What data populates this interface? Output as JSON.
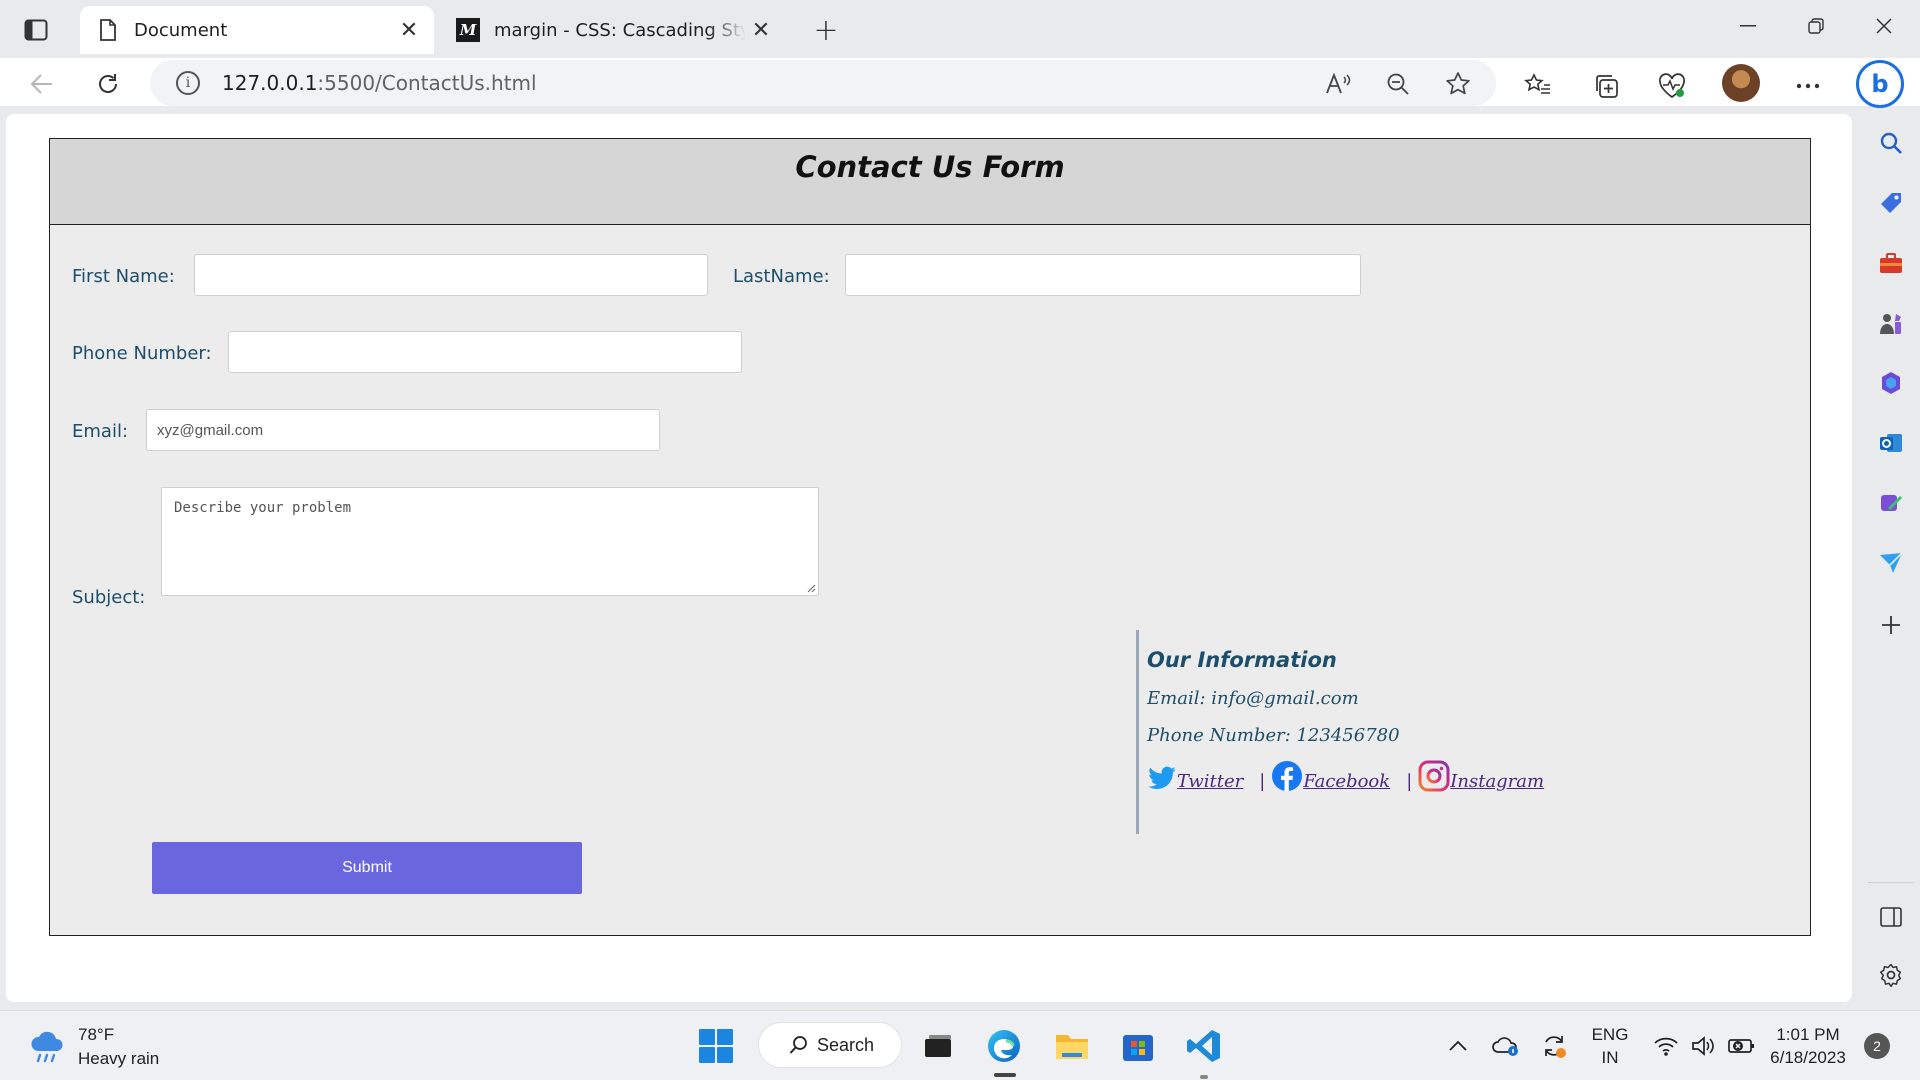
{
  "browser": {
    "tabs": [
      {
        "title": "Document",
        "close_label": "✕"
      },
      {
        "title": "margin - CSS: Cascading Style Sh",
        "close_label": "✕",
        "favicon_text": "M"
      }
    ],
    "new_tab_label": "+",
    "address": {
      "host": "127.0.0.1",
      "path": ":5500/ContactUs.html",
      "info_label": "i"
    },
    "bing_label": "b"
  },
  "page": {
    "header_title": "Contact Us Form",
    "form": {
      "first_name_label": "First Name:",
      "first_name_value": "",
      "last_name_label": "LastName:",
      "last_name_value": "",
      "phone_label": "Phone Number:",
      "phone_value": "",
      "email_label": "Email:",
      "email_placeholder": "xyz@gmail.com",
      "subject_label": "Subject:",
      "subject_placeholder": "Describe your problem",
      "submit_label": "Submit"
    },
    "info": {
      "heading": "Our Information",
      "email": "Email: info@gmail.com",
      "phone": "Phone Number: 123456780",
      "social": [
        {
          "label": " Twitter",
          "icon": "twitter-icon",
          "color": "#1d9bf0"
        },
        {
          "label": " Facebook",
          "icon": "facebook-icon",
          "color": "#1877f2"
        },
        {
          "label": " Instagram",
          "icon": "instagram-icon",
          "color": "#c13584"
        }
      ],
      "separator": "|"
    }
  },
  "taskbar": {
    "weather_temp": "78°F",
    "weather_desc": "Heavy rain",
    "search_label": "Search",
    "lang_top": "ENG",
    "lang_bottom": "IN",
    "time": "1:01 PM",
    "date": "6/18/2023",
    "notification_count": "2"
  },
  "colors": {
    "accent_button": "#6a67de",
    "label_text": "#1d4e6b",
    "link_text": "#4b2a7e",
    "header_bg": "#d6d6d6",
    "form_bg": "#ececec"
  }
}
